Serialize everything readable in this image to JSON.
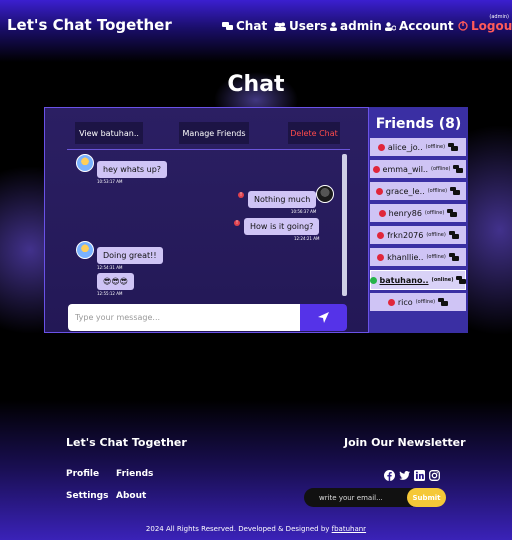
{
  "header": {
    "brand": "Let's Chat Together",
    "nav": {
      "chat": "Chat",
      "users": "Users",
      "admin": "admin",
      "account": "Account",
      "logout": "Logout"
    },
    "role_tag": "(admin)"
  },
  "page_title": "Chat",
  "chat": {
    "view_profile": "View batuhan..",
    "manage_friends": "Manage Friends",
    "delete_chat": "Delete Chat",
    "messages": [
      {
        "text": "hey whats up?",
        "time": "10:53:17 AM",
        "side": "left"
      },
      {
        "text": "Nothing much",
        "time": "10:56:37 AM",
        "side": "right"
      },
      {
        "text": "How is it going?",
        "time": "12:24:21 AM",
        "side": "right"
      },
      {
        "text": "Doing great!!",
        "time": "12:54:31 AM",
        "side": "left"
      },
      {
        "text": "😎😎😎",
        "time": "12:55:12 AM",
        "side": "left"
      }
    ],
    "input_placeholder": "Type your message...",
    "error_mark": "!"
  },
  "friends": {
    "title": "Friends (8)",
    "list": [
      {
        "name": "alice_jo..",
        "status": "(offline)"
      },
      {
        "name": "emma_wil..",
        "status": "(offline)"
      },
      {
        "name": "grace_le..",
        "status": "(offline)"
      },
      {
        "name": "henry86",
        "status": "(offline)"
      },
      {
        "name": "frkn2076",
        "status": "(offline)"
      },
      {
        "name": "khanllie..",
        "status": "(offline)"
      },
      {
        "name": "batuhano..",
        "status": "(online)"
      },
      {
        "name": "rico",
        "status": "(offline)"
      }
    ]
  },
  "footer": {
    "brand": "Let's Chat Together",
    "links": {
      "profile": "Profile",
      "friends": "Friends",
      "settings": "Settings",
      "about": "About"
    },
    "newsletter_title": "Join Our Newsletter",
    "email_placeholder": "write your email...",
    "submit": "Submit",
    "copyright": "2024 All Rights Reserved. Developed & Designed by ",
    "author": "fbatuhanr"
  },
  "colors": {
    "accent": "#5533e8",
    "logout": "#ff5a5a",
    "online": "#26b34a",
    "offline": "#e0263b",
    "submit": "#f5c838"
  },
  "icons": [
    "chat-icon",
    "users-icon",
    "user-icon",
    "account-icon",
    "logout-icon",
    "send-icon",
    "facebook-icon",
    "twitter-icon",
    "linkedin-icon",
    "instagram-icon"
  ]
}
